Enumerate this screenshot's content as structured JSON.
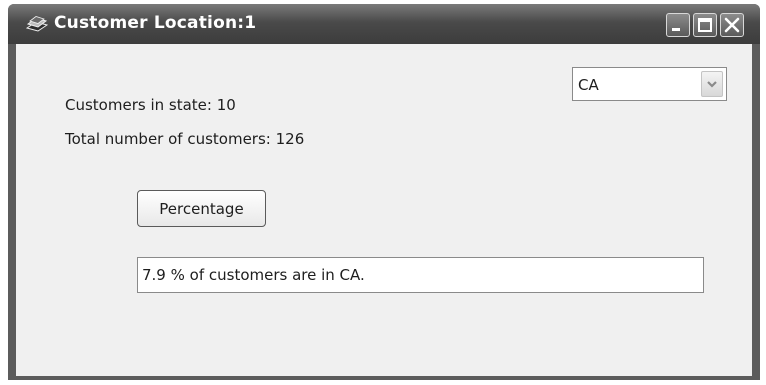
{
  "window": {
    "title": "Customer Location:1",
    "icon": "app-books-icon",
    "controls": [
      "minimize-icon",
      "maximize-icon",
      "close-icon"
    ]
  },
  "labels": {
    "customers_in_state": "Customers in state: 10",
    "total_customers": "Total number of customers: 126"
  },
  "state_select": {
    "selected": "CA",
    "icon": "chevron-down-icon"
  },
  "percentage_button": {
    "label": "Percentage"
  },
  "result_field": {
    "value": "7.9 % of customers are in CA."
  }
}
